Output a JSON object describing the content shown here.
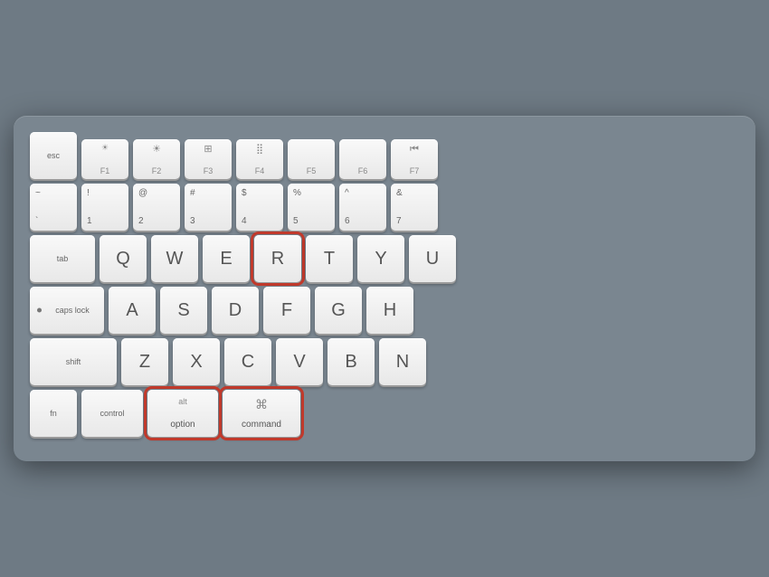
{
  "keyboard": {
    "rows": [
      {
        "id": "function-row",
        "keys": [
          {
            "id": "esc",
            "label": "esc",
            "width": "esc",
            "type": "special"
          },
          {
            "id": "f1",
            "top": "☀",
            "bottom": "F1",
            "width": "f",
            "type": "fn"
          },
          {
            "id": "f2",
            "top": "☀",
            "bottom": "F2",
            "width": "f",
            "type": "fn"
          },
          {
            "id": "f3",
            "top": "⊞",
            "bottom": "F3",
            "width": "f",
            "type": "fn"
          },
          {
            "id": "f4",
            "top": "⠿",
            "bottom": "F4",
            "width": "f",
            "type": "fn"
          },
          {
            "id": "f5",
            "bottom": "F5",
            "width": "f",
            "type": "fn"
          },
          {
            "id": "f6",
            "bottom": "F6",
            "width": "f",
            "type": "fn"
          },
          {
            "id": "f7",
            "top": "⏮",
            "bottom": "F7",
            "width": "f",
            "type": "fn"
          }
        ]
      },
      {
        "id": "number-row",
        "keys": [
          {
            "id": "tilde",
            "top": "~",
            "bottom": "`",
            "type": "char"
          },
          {
            "id": "1",
            "top": "!",
            "bottom": "1",
            "type": "char"
          },
          {
            "id": "2",
            "top": "@",
            "bottom": "2",
            "type": "char"
          },
          {
            "id": "3",
            "top": "#",
            "bottom": "3",
            "type": "char"
          },
          {
            "id": "4",
            "top": "$",
            "bottom": "4",
            "type": "char"
          },
          {
            "id": "5",
            "top": "%",
            "bottom": "5",
            "type": "char"
          },
          {
            "id": "6",
            "top": "^",
            "bottom": "6",
            "type": "char"
          },
          {
            "id": "7",
            "top": "&",
            "bottom": "7",
            "type": "char"
          }
        ]
      },
      {
        "id": "qwerty-row",
        "keys": [
          {
            "id": "tab",
            "label": "tab",
            "width": "tab",
            "type": "special"
          },
          {
            "id": "q",
            "label": "Q",
            "type": "alpha"
          },
          {
            "id": "w",
            "label": "W",
            "type": "alpha"
          },
          {
            "id": "e",
            "label": "E",
            "type": "alpha"
          },
          {
            "id": "r",
            "label": "R",
            "type": "alpha",
            "highlighted": true
          },
          {
            "id": "t",
            "label": "T",
            "type": "alpha"
          },
          {
            "id": "y",
            "label": "Y",
            "type": "alpha"
          },
          {
            "id": "u",
            "label": "U",
            "type": "alpha",
            "partial": true
          }
        ]
      },
      {
        "id": "asdf-row",
        "keys": [
          {
            "id": "caps-lock",
            "label": "caps lock",
            "width": "caps",
            "type": "special",
            "hasDot": true
          },
          {
            "id": "a",
            "label": "A",
            "type": "alpha"
          },
          {
            "id": "s",
            "label": "S",
            "type": "alpha"
          },
          {
            "id": "d",
            "label": "D",
            "type": "alpha"
          },
          {
            "id": "f",
            "label": "F",
            "type": "alpha"
          },
          {
            "id": "g",
            "label": "G",
            "type": "alpha"
          },
          {
            "id": "h",
            "label": "H",
            "type": "alpha"
          }
        ]
      },
      {
        "id": "zxcv-row",
        "keys": [
          {
            "id": "shift",
            "label": "shift",
            "width": "shift",
            "type": "special"
          },
          {
            "id": "z",
            "label": "Z",
            "type": "alpha"
          },
          {
            "id": "x",
            "label": "X",
            "type": "alpha"
          },
          {
            "id": "c",
            "label": "C",
            "type": "alpha"
          },
          {
            "id": "v",
            "label": "V",
            "type": "alpha"
          },
          {
            "id": "b",
            "label": "B",
            "type": "alpha"
          },
          {
            "id": "n",
            "label": "N",
            "type": "alpha"
          }
        ]
      },
      {
        "id": "bottom-row",
        "keys": [
          {
            "id": "fn",
            "label": "fn",
            "width": "fn",
            "type": "special"
          },
          {
            "id": "control",
            "label": "control",
            "width": "control",
            "type": "special"
          },
          {
            "id": "option",
            "top": "alt",
            "bottom": "option",
            "width": "option",
            "type": "special",
            "highlighted": true
          },
          {
            "id": "command",
            "top": "⌘",
            "bottom": "command",
            "width": "command",
            "type": "special",
            "highlighted": true
          }
        ]
      }
    ],
    "highlight_color": "#c0392b"
  }
}
